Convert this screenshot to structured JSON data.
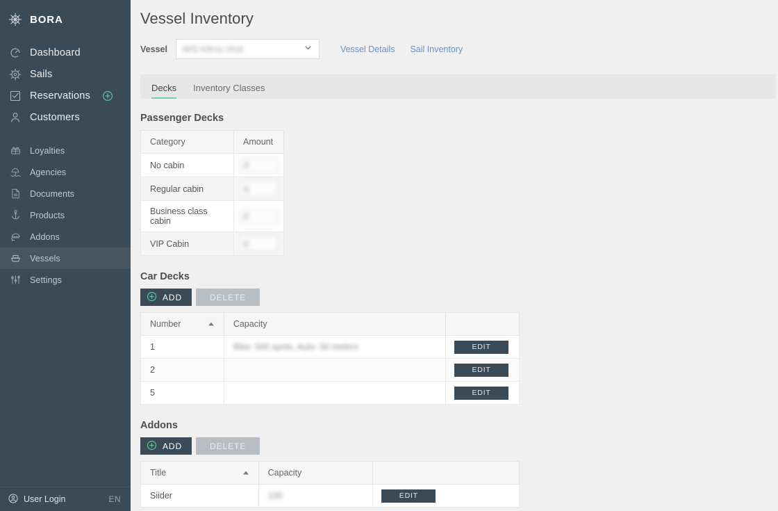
{
  "sidebar": {
    "brand": {
      "name": "BORA",
      "icon": "compass-rose-icon"
    },
    "primary_items": [
      {
        "label": "Dashboard",
        "icon": "gauge-icon",
        "active": false
      },
      {
        "label": "Sails",
        "icon": "ships-wheel-icon",
        "active": false
      },
      {
        "label": "Reservations",
        "icon": "checklist-icon",
        "active": false,
        "badge": "plus-circle-icon"
      },
      {
        "label": "Customers",
        "icon": "person-icon",
        "active": false
      }
    ],
    "secondary_items": [
      {
        "label": "Loyalties",
        "icon": "gift-icon",
        "active": false
      },
      {
        "label": "Agencies",
        "icon": "beach-umbrella-icon",
        "active": false
      },
      {
        "label": "Documents",
        "icon": "document-icon",
        "active": false
      },
      {
        "label": "Products",
        "icon": "anchor-icon",
        "active": false
      },
      {
        "label": "Addons",
        "icon": "hand-serving-icon",
        "active": false
      },
      {
        "label": "Vessels",
        "icon": "boat-icon",
        "active": true
      },
      {
        "label": "Settings",
        "icon": "sliders-icon",
        "active": false
      }
    ],
    "footer": {
      "user_label": "User Login",
      "user_icon": "user-circle-icon",
      "language": "EN"
    }
  },
  "header": {
    "title": "Vessel Inventory",
    "vessel_label": "Vessel",
    "vessel_value": "M/S Kõrvu Vind",
    "vessel_chevron_icon": "chevron-down-icon",
    "links": [
      {
        "label": "Vessel Details"
      },
      {
        "label": "Sail Inventory"
      }
    ]
  },
  "tabs": [
    {
      "label": "Decks",
      "active": true
    },
    {
      "label": "Inventory Classes",
      "active": false
    }
  ],
  "passenger_decks": {
    "title": "Passenger Decks",
    "columns": [
      "Category",
      "Amount"
    ],
    "rows": [
      {
        "category": "No cabin",
        "amount": "0"
      },
      {
        "category": "Regular cabin",
        "amount": "0"
      },
      {
        "category": "Business class cabin",
        "amount": "0"
      },
      {
        "category": "VIP Cabin",
        "amount": "0"
      }
    ]
  },
  "car_decks": {
    "title": "Car Decks",
    "add_label": "ADD",
    "add_icon": "plus-circle-icon",
    "delete_label": "DELETE",
    "columns": [
      "Number",
      "Capacity",
      ""
    ],
    "sort_icon": "sort-asc-caret-icon",
    "edit_label": "EDIT",
    "rows": [
      {
        "number": "1",
        "capacity": "Bike: 500 spots, Auto: 50 meters"
      },
      {
        "number": "2",
        "capacity": ""
      },
      {
        "number": "5",
        "capacity": ""
      }
    ]
  },
  "addons": {
    "title": "Addons",
    "add_label": "ADD",
    "add_icon": "plus-circle-icon",
    "delete_label": "DELETE",
    "columns": [
      "Title",
      "Capacity",
      ""
    ],
    "sort_icon": "sort-asc-caret-icon",
    "edit_label": "EDIT",
    "rows": [
      {
        "title": "Siider",
        "capacity": "100"
      }
    ]
  },
  "colors": {
    "sidebar_bg": "#3b4a57",
    "sidebar_active": "#46555f",
    "accent_teal": "#6fcfa8",
    "link_blue": "#6b8fbb",
    "page_bg": "#f0f0f0",
    "tabbar_bg": "#e7e7e7",
    "button_dark": "#3b4a57",
    "button_disabled": "#b8bec4"
  }
}
